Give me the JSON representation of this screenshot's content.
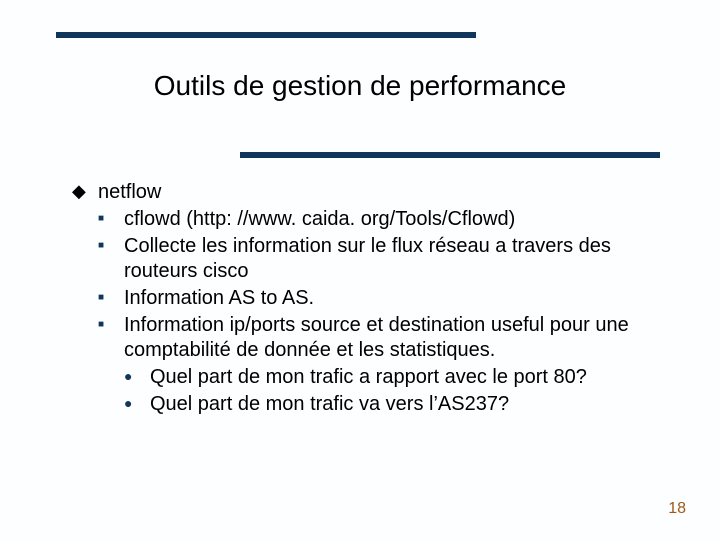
{
  "title": "Outils de gestion de performance",
  "bullets": {
    "lvl1_0": "netflow",
    "lvl2_0": "cflowd (http: //www. caida. org/Tools/Cflowd)",
    "lvl2_1": "Collecte les information sur le flux réseau a travers des routeurs cisco",
    "lvl2_2": "Information AS to AS.",
    "lvl2_3": "Information ip/ports source et  destination useful pour une comptabilité de donnée et les statistiques.",
    "lvl3_0": "Quel part de mon trafic a rapport avec le port 80?",
    "lvl3_1": "Quel part de mon trafic va vers l’AS237?"
  },
  "page_number": "18"
}
